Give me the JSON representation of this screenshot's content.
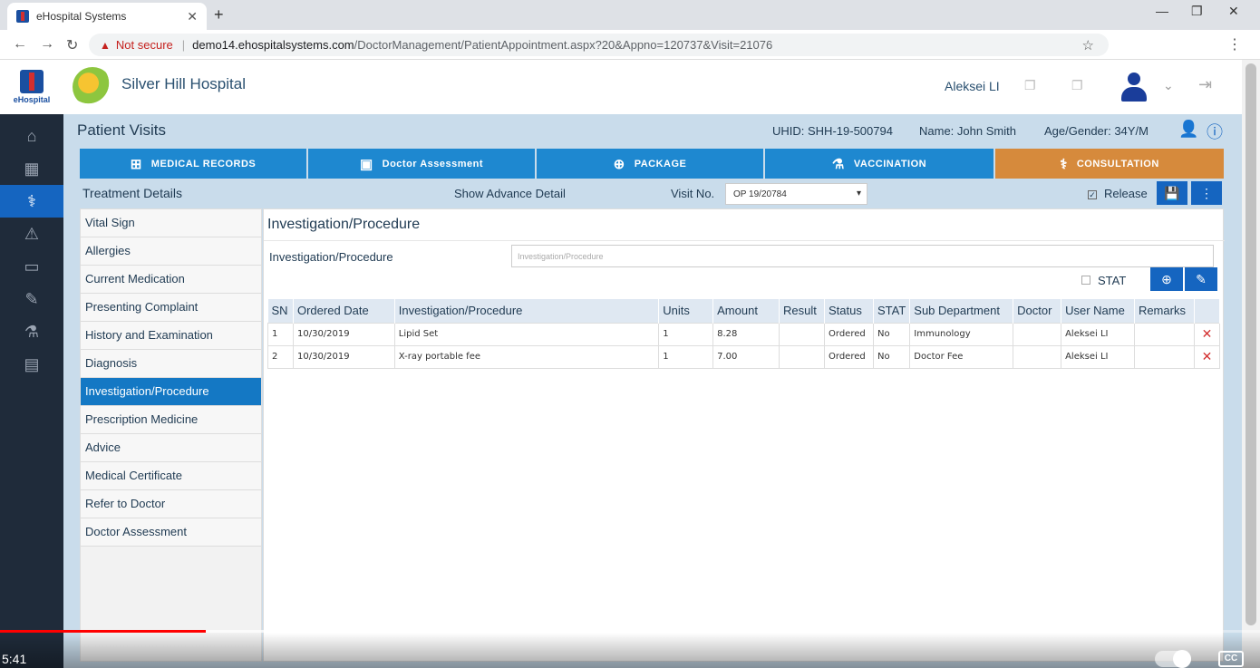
{
  "browser": {
    "tab_title": "eHospital Systems",
    "not_secure": "Not secure",
    "url_host": "demo14.ehospitalsystems.com",
    "url_path": "/DoctorManagement/PatientAppointment.aspx?20&Appno=120737&Visit=21076"
  },
  "leftnav": {
    "logo_text": "eHospital"
  },
  "header": {
    "hospital_name": "Silver Hill Hospital",
    "user_name": "Aleksei LI"
  },
  "patient": {
    "page_title": "Patient Visits",
    "uhid": "UHID: SHH-19-500794",
    "name": "Name: John Smith",
    "age_gender": "Age/Gender: 34Y/M"
  },
  "tabs": [
    {
      "label": "MEDICAL RECORDS"
    },
    {
      "label": "Doctor Assessment"
    },
    {
      "label": "PACKAGE"
    },
    {
      "label": "VACCINATION"
    },
    {
      "label": "CONSULTATION"
    }
  ],
  "treatment": {
    "title": "Treatment Details",
    "advance_link": "Show Advance Detail",
    "visit_label": "Visit No.",
    "visit_value": "OP 19/20784",
    "release_label": "Release"
  },
  "side_items": [
    "Vital Sign",
    "Allergies",
    "Current Medication",
    "Presenting Complaint",
    "History and Examination",
    "Diagnosis",
    "Investigation/Procedure",
    "Prescription Medicine",
    "Advice",
    "Medical Certificate",
    "Refer to Doctor",
    "Doctor Assessment"
  ],
  "content": {
    "title": "Investigation/Procedure",
    "field_label": "Investigation/Procedure",
    "field_placeholder": "Investigation/Procedure",
    "stat_label": "STAT"
  },
  "table": {
    "headers": [
      "SN",
      "Ordered Date",
      "Investigation/Procedure",
      "Units",
      "Amount",
      "Result",
      "Status",
      "STAT",
      "Sub Department",
      "Doctor",
      "User Name",
      "Remarks",
      ""
    ],
    "rows": [
      [
        "1",
        "10/30/2019",
        "Lipid Set",
        "1",
        "8.28",
        "",
        "Ordered",
        "No",
        "Immunology",
        "",
        "Aleksei LI",
        ""
      ],
      [
        "2",
        "10/30/2019",
        "X-ray portable fee",
        "1",
        "7.00",
        "",
        "Ordered",
        "No",
        "Doctor Fee",
        "",
        "Aleksei LI",
        ""
      ]
    ]
  },
  "video": {
    "time": "5:41",
    "progress": 0.163,
    "buffered": 0.337,
    "cc_label": "CC"
  }
}
